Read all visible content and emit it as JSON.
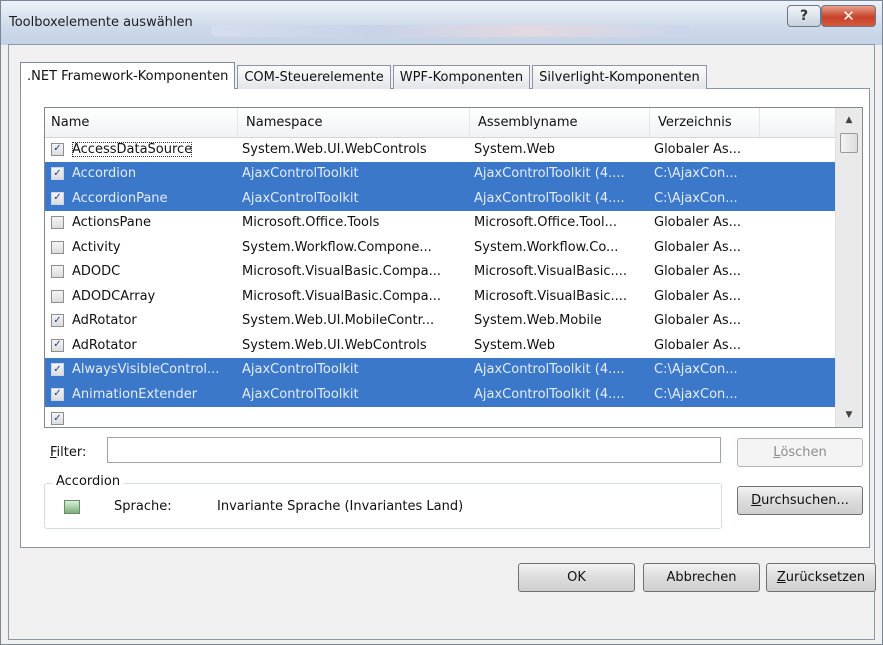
{
  "window": {
    "title": "Toolboxelemente auswählen",
    "help_label": "?",
    "close_label": "✕"
  },
  "tabs": [
    {
      "label": ".NET Framework-Komponenten"
    },
    {
      "label": "COM-Steuerelemente"
    },
    {
      "label": "WPF-Komponenten"
    },
    {
      "label": "Silverlight-Komponenten"
    }
  ],
  "table": {
    "columns": [
      "Name",
      "Namespace",
      "Assemblyname",
      "Verzeichnis"
    ],
    "rows": [
      {
        "checked": true,
        "selected": false,
        "name": "AccessDataSource",
        "namespace": "System.Web.UI.WebControls",
        "assembly": "System.Web",
        "dir": "Globaler As..."
      },
      {
        "checked": true,
        "selected": true,
        "name": "Accordion",
        "namespace": "AjaxControlToolkit",
        "assembly": "AjaxControlToolkit (4....",
        "dir": "C:\\AjaxCon..."
      },
      {
        "checked": true,
        "selected": true,
        "name": "AccordionPane",
        "namespace": "AjaxControlToolkit",
        "assembly": "AjaxControlToolkit (4....",
        "dir": "C:\\AjaxCon..."
      },
      {
        "checked": false,
        "selected": false,
        "name": "ActionsPane",
        "namespace": "Microsoft.Office.Tools",
        "assembly": "Microsoft.Office.Tool...",
        "dir": "Globaler As..."
      },
      {
        "checked": false,
        "selected": false,
        "name": "Activity",
        "namespace": "System.Workflow.Compone...",
        "assembly": "System.Workflow.Co...",
        "dir": "Globaler As..."
      },
      {
        "checked": false,
        "selected": false,
        "name": "ADODC",
        "namespace": "Microsoft.VisualBasic.Compa...",
        "assembly": "Microsoft.VisualBasic....",
        "dir": "Globaler As..."
      },
      {
        "checked": false,
        "selected": false,
        "name": "ADODCArray",
        "namespace": "Microsoft.VisualBasic.Compa...",
        "assembly": "Microsoft.VisualBasic....",
        "dir": "Globaler As..."
      },
      {
        "checked": true,
        "selected": false,
        "name": "AdRotator",
        "namespace": "System.Web.UI.MobileContr...",
        "assembly": "System.Web.Mobile",
        "dir": "Globaler As..."
      },
      {
        "checked": true,
        "selected": false,
        "name": "AdRotator",
        "namespace": "System.Web.UI.WebControls",
        "assembly": "System.Web",
        "dir": "Globaler As..."
      },
      {
        "checked": true,
        "selected": true,
        "name": "AlwaysVisibleControl...",
        "namespace": "AjaxControlToolkit",
        "assembly": "AjaxControlToolkit (4....",
        "dir": "C:\\AjaxCon..."
      },
      {
        "checked": true,
        "selected": true,
        "name": "AnimationExtender",
        "namespace": "AjaxControlToolkit",
        "assembly": "AjaxControlToolkit (4....",
        "dir": "C:\\AjaxCon..."
      },
      {
        "checked": true,
        "selected": false,
        "name": "",
        "namespace": "",
        "assembly": "",
        "dir": ""
      }
    ]
  },
  "filter": {
    "label_prefix": "",
    "label_key": "F",
    "label_rest": "ilter:",
    "value": ""
  },
  "clear_button": {
    "key": "L",
    "rest": "öschen"
  },
  "selection_group": {
    "title": "Accordion",
    "lang_label": "Sprache:",
    "lang_value": "Invariante Sprache (Invariantes Land)"
  },
  "browse_button": {
    "key": "D",
    "rest": "urchsuchen..."
  },
  "footer": {
    "ok": "OK",
    "cancel": "Abbrechen",
    "reset_key": "Z",
    "reset_rest": "urücksetzen"
  }
}
